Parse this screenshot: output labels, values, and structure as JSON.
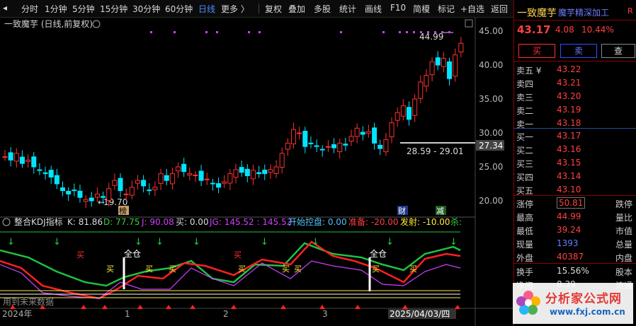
{
  "toolbar": {
    "items": [
      "分时",
      "1分钟",
      "5分钟",
      "15分钟",
      "30分钟",
      "60分钟",
      "日线",
      "更多 〉",
      "复权",
      "叠加",
      "多股",
      "统计",
      "画线",
      "F10",
      "简榎",
      "标记",
      "+自选",
      "返回"
    ]
  },
  "chart": {
    "stock_label": "一致魔芋 (日线,前复权)",
    "price_axis": [
      "45.00",
      "40.00",
      "35.00",
      "30.00",
      "25.00",
      "20.00"
    ],
    "high_label": "44.99",
    "low_label": "19.70",
    "range_label": "28.59 - 29.01",
    "current_line_label": "27.34",
    "markers": {
      "bang": "榜",
      "cai": "财",
      "jian": "减"
    }
  },
  "indicator": {
    "header": {
      "name": "整合KDJ指标",
      "k": "K: 81.86",
      "d": "D: 77.75",
      "j": "J: 90.08",
      "buy": "买: 0.00",
      "jg": "JG: 145.52 : 145.52",
      "kaishi": "开始控盘: 0.00",
      "zhunbei": "准备: -20.00",
      "fashe": "发射: -10.00",
      "sha": "杀:"
    },
    "labels": {
      "quancang": "全仓",
      "mai": "买",
      "mai_yellow": "买"
    },
    "footnote": "用到未来数据"
  },
  "date_axis": {
    "ticks": [
      "2024年",
      "1",
      "2",
      "3",
      "2025/04/03/四"
    ]
  },
  "panel": {
    "name": "一致魔芋",
    "sector": "魔芋精深加工",
    "r_mark": "R",
    "price": "43.17",
    "change": "4.08",
    "pct": "10.44%",
    "buy_btn": "买",
    "sell_btn": "卖",
    "check_btn": "查",
    "asks": [
      {
        "label": "卖五 ¥",
        "price": "43.22"
      },
      {
        "label": "卖四",
        "price": "43.21"
      },
      {
        "label": "卖三",
        "price": "43.20"
      },
      {
        "label": "卖二",
        "price": "43.19"
      },
      {
        "label": "卖一",
        "price": "43.18"
      }
    ],
    "bids": [
      {
        "label": "买一",
        "price": "43.17"
      },
      {
        "label": "买二",
        "price": "43.16"
      },
      {
        "label": "买三",
        "price": "43.15"
      },
      {
        "label": "买四",
        "price": "43.14"
      },
      {
        "label": "买五",
        "price": "43.10"
      }
    ],
    "stats": [
      {
        "label": "涨停",
        "value": "50.81",
        "right": "跌停"
      },
      {
        "label": "最高",
        "value": "44.99",
        "right": "量比"
      },
      {
        "label": "最低",
        "value": "39.24",
        "right": "市值"
      },
      {
        "label": "现量",
        "value": "1393",
        "right": "总量"
      },
      {
        "label": "外盘",
        "value": "40387",
        "right": "内盘"
      },
      {
        "label": "换手",
        "value": "15.56%",
        "right": "股本"
      },
      {
        "label": "净资",
        "value": "8.39",
        "right": "流通"
      }
    ]
  },
  "watermark": {
    "text": "分析家公式网",
    "url": "www.fxj.com.cn"
  },
  "colors": {
    "up": "#ff3030",
    "down": "#00e5ff",
    "k": "#ff2020",
    "d": "#00c040",
    "j": "#d040ff",
    "bg": "#000000",
    "accent": "#4f8cff"
  }
}
